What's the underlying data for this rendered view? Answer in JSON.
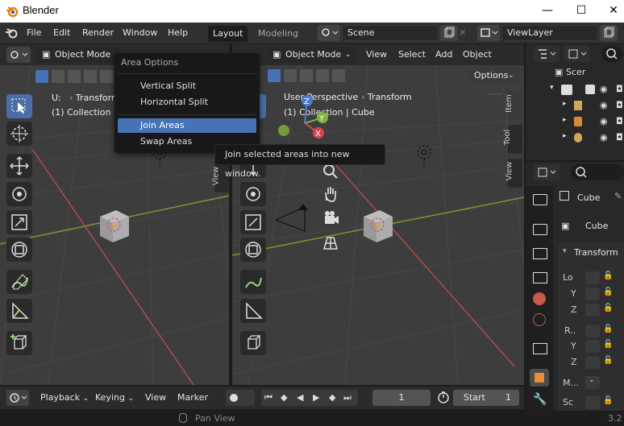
{
  "window": {
    "title": "Blender",
    "minimize": "—",
    "maximize": "☐",
    "close": "✕"
  },
  "menubar": {
    "items": [
      "File",
      "Edit",
      "Render",
      "Window",
      "Help"
    ]
  },
  "workspaces": {
    "tabs": [
      "Layout",
      "Modeling"
    ],
    "active": "Layout"
  },
  "scene": {
    "name": "Scene",
    "viewlayer": "ViewLayer"
  },
  "left_viewport": {
    "mode": "Object Mode",
    "overlay_text_1": "U:",
    "breadcrumb": "Transform",
    "collection_text": "(1) Collection |"
  },
  "popup": {
    "title": "Area Options",
    "items": [
      "Vertical Split",
      "Horizontal Split",
      "Join Areas",
      "Swap Areas"
    ],
    "highlighted": "Join Areas"
  },
  "tooltip": {
    "text": "Join selected areas into new window."
  },
  "right_viewport": {
    "mode": "Object Mode",
    "menus": [
      "View",
      "Select",
      "Add",
      "Object"
    ],
    "options": "Options",
    "perspective": "User Perspective",
    "breadcrumb": "Transform",
    "collection_text": "(1) Collection | Cube",
    "side_tabs": [
      "Item",
      "Tool",
      "View"
    ],
    "gizmo_axes": {
      "z": "Z",
      "y": "Y",
      "x": "X"
    }
  },
  "left_side_tab": "View",
  "outliner": {
    "root": "Scer"
  },
  "properties": {
    "object_name": "Cube",
    "data_name": "Cube",
    "section": "Transform",
    "rows": [
      "Lo",
      "Y",
      "Z",
      "R..",
      "Y",
      "Z",
      "M...",
      "Sc"
    ]
  },
  "timeline": {
    "menus": [
      "Playback",
      "Keying",
      "View",
      "Marker"
    ],
    "current_frame": "1",
    "start_label": "Start",
    "start_value": "1"
  },
  "statusbar": {
    "left_text": "Pan View",
    "version": "3.2"
  },
  "colors": {
    "accent": "#4772b3",
    "active_tool": "#4b6ea8",
    "grid_red": "#b34a4a",
    "grid_green": "#7a9a33"
  }
}
